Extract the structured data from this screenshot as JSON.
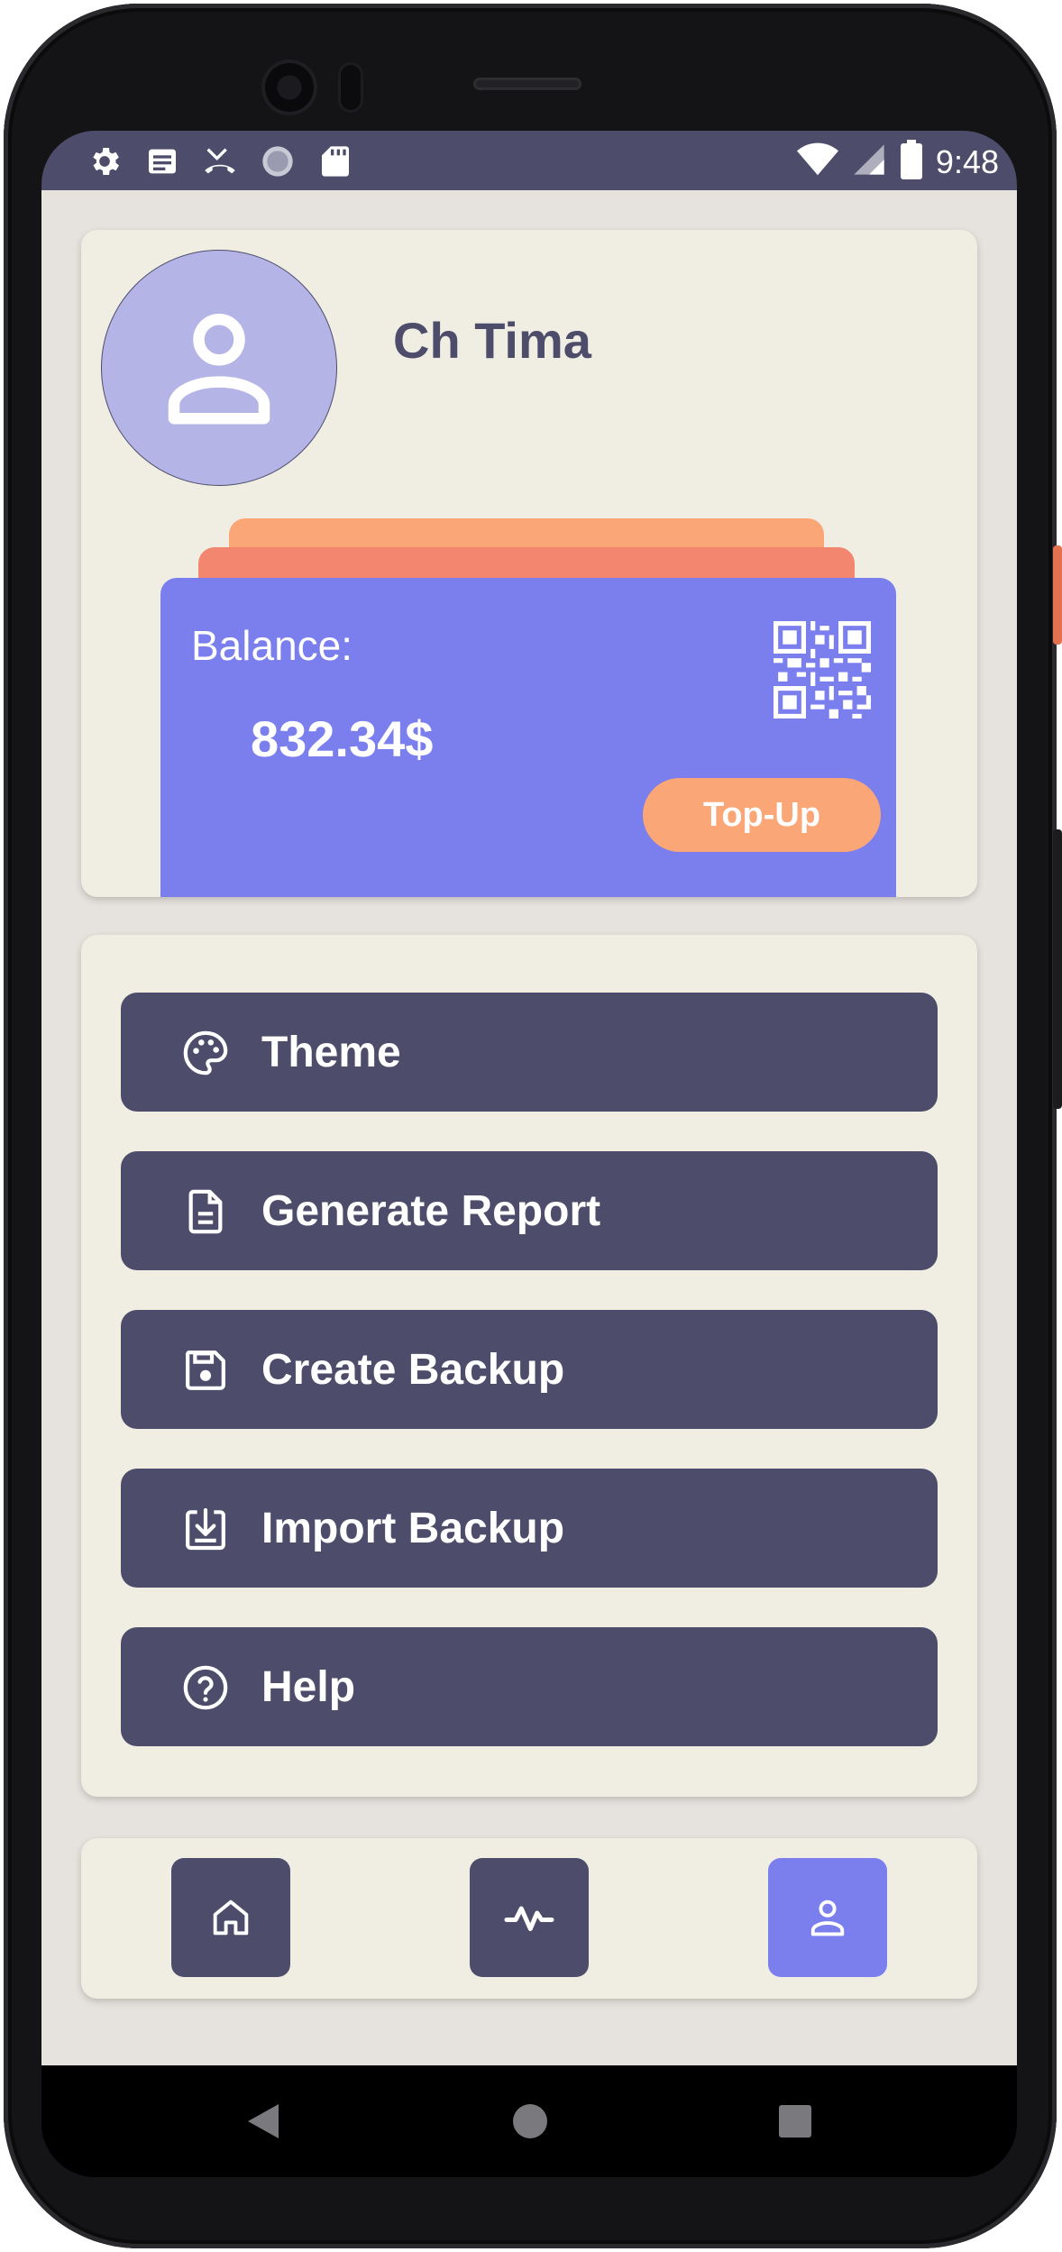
{
  "status_bar": {
    "time": "9:48",
    "left_icons": [
      "settings-icon",
      "notes-icon",
      "call-missed-icon",
      "loading-circle-icon",
      "sd-card-icon"
    ],
    "right_icons": [
      "wifi-icon",
      "signal-icon",
      "battery-icon"
    ]
  },
  "profile": {
    "name": "Ch Tima",
    "balance_label": "Balance:",
    "balance_value": "832.34$",
    "topup_label": "Top-Up",
    "avatar_icon": "person-icon",
    "qr_icon": "qr-code-icon"
  },
  "menu": {
    "items": [
      {
        "label": "Theme",
        "icon": "palette-icon"
      },
      {
        "label": "Generate Report",
        "icon": "document-icon"
      },
      {
        "label": "Create Backup",
        "icon": "save-icon"
      },
      {
        "label": "Import Backup",
        "icon": "import-icon"
      },
      {
        "label": "Help",
        "icon": "help-icon"
      }
    ]
  },
  "bottom_nav": {
    "items": [
      {
        "icon": "home-icon",
        "active": false
      },
      {
        "icon": "activity-icon",
        "active": false
      },
      {
        "icon": "profile-icon",
        "active": true
      }
    ]
  },
  "colors": {
    "primary_dark": "#4d4d6b",
    "accent": "#7b7fee",
    "orange": "#fba676",
    "card_bg": "#f0ede3",
    "screen_bg": "#e6e2de"
  }
}
